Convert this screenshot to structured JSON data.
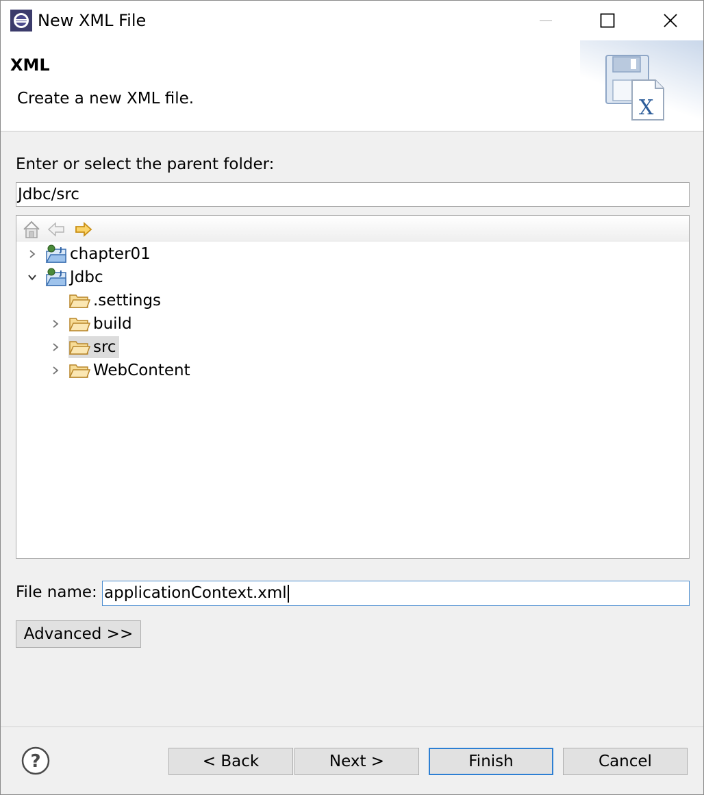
{
  "window": {
    "title": "New XML File",
    "icons": {
      "app": "eclipse-icon",
      "minimize": "minimize-icon",
      "maximize": "maximize-icon",
      "close": "close-icon"
    }
  },
  "banner": {
    "title": "XML",
    "message": "Create a new XML file.",
    "icon": "new-xml-file-wizard-icon"
  },
  "parent_folder": {
    "label": "Enter or select the parent folder:",
    "value": "Jdbc/src"
  },
  "tree": {
    "toolbar": [
      "home-icon",
      "back-arrow-icon",
      "forward-arrow-icon"
    ],
    "items": [
      {
        "label": "chapter01",
        "icon": "project-icon",
        "expanded": false,
        "has_children": true,
        "depth": 0
      },
      {
        "label": "Jdbc",
        "icon": "project-icon",
        "expanded": true,
        "has_children": true,
        "depth": 0
      },
      {
        "label": ".settings",
        "icon": "folder-icon",
        "expanded": false,
        "has_children": false,
        "depth": 1
      },
      {
        "label": "build",
        "icon": "folder-icon",
        "expanded": false,
        "has_children": true,
        "depth": 1
      },
      {
        "label": "src",
        "icon": "folder-icon",
        "expanded": false,
        "has_children": true,
        "depth": 1,
        "selected": true
      },
      {
        "label": "WebContent",
        "icon": "folder-icon",
        "expanded": false,
        "has_children": true,
        "depth": 1
      }
    ]
  },
  "file_name": {
    "label": "File name:",
    "value": "applicationContext.xml"
  },
  "buttons": {
    "advanced": "Advanced >>",
    "back": "< Back",
    "next": "Next >",
    "finish": "Finish",
    "cancel": "Cancel"
  },
  "colors": {
    "focus_border": "#2d7fd3",
    "selection": "#dcdcdc",
    "folder": "#e8b04a"
  }
}
